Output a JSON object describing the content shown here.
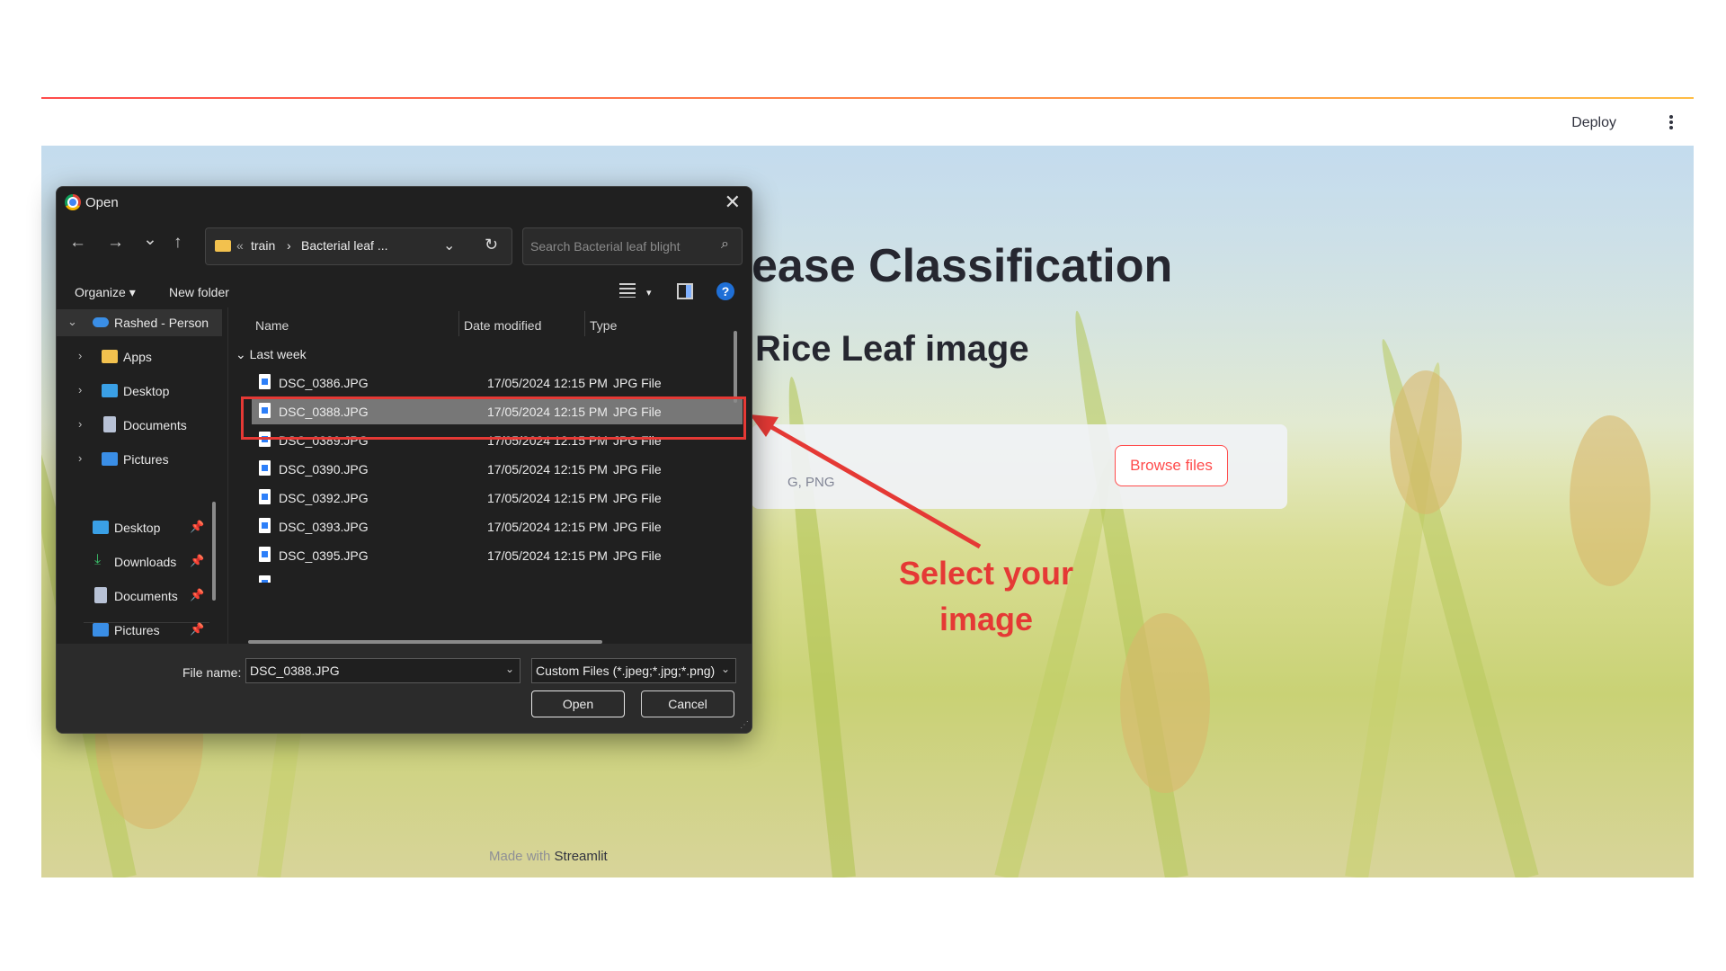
{
  "header": {
    "deploy_label": "Deploy",
    "menu_icon": "kebab-icon"
  },
  "app": {
    "title_visible": "ease Classification",
    "subtitle_visible": "Rice Leaf image",
    "uploader_hint_visible": "G, PNG",
    "browse_label": "Browse files",
    "footer_prefix": "Made with",
    "footer_brand": "Streamlit"
  },
  "annotation": {
    "line1": "Select your",
    "line2": "image",
    "color": "#e53935"
  },
  "dialog": {
    "title": "Open",
    "close": "✕",
    "nav": {
      "back": "←",
      "forward": "→",
      "recent": "⌄",
      "up": "↑"
    },
    "path": {
      "prefix": "«",
      "segment1": "train",
      "arrow": "›",
      "segment2": "Bacterial leaf ..."
    },
    "search_placeholder": "Search Bacterial leaf blight",
    "commands": {
      "organize": "Organize ▾",
      "new_folder": "New folder",
      "help": "?"
    },
    "sidebar": [
      {
        "label": "Rashed - Person",
        "chev": "⌄"
      },
      {
        "label": "Apps",
        "chev": "›"
      },
      {
        "label": "Desktop",
        "chev": "›"
      },
      {
        "label": "Documents",
        "chev": "›"
      },
      {
        "label": "Pictures",
        "chev": "›"
      },
      {
        "label": "Desktop",
        "pin": "📌"
      },
      {
        "label": "Downloads",
        "pin": "📌"
      },
      {
        "label": "Documents",
        "pin": "📌"
      },
      {
        "label": "Pictures",
        "pin": "📌"
      }
    ],
    "columns": {
      "name": "Name",
      "date": "Date modified",
      "type": "Type"
    },
    "group": "⌄  Last week",
    "files": [
      {
        "name": "DSC_0386.JPG",
        "date": "17/05/2024 12:15 PM",
        "type": "JPG File"
      },
      {
        "name": "DSC_0388.JPG",
        "date": "17/05/2024 12:15 PM",
        "type": "JPG File"
      },
      {
        "name": "DSC_0389.JPG",
        "date": "17/05/2024 12:15 PM",
        "type": "JPG File"
      },
      {
        "name": "DSC_0390.JPG",
        "date": "17/05/2024 12:15 PM",
        "type": "JPG File"
      },
      {
        "name": "DSC_0392.JPG",
        "date": "17/05/2024 12:15 PM",
        "type": "JPG File"
      },
      {
        "name": "DSC_0393.JPG",
        "date": "17/05/2024 12:15 PM",
        "type": "JPG File"
      },
      {
        "name": "DSC_0395.JPG",
        "date": "17/05/2024 12:15 PM",
        "type": "JPG File"
      }
    ],
    "file_name_label": "File name:",
    "file_name_value": "DSC_0388.JPG",
    "file_type_value": "Custom Files (*.jpeg;*.jpg;*.png)",
    "open_label": "Open",
    "cancel_label": "Cancel"
  }
}
